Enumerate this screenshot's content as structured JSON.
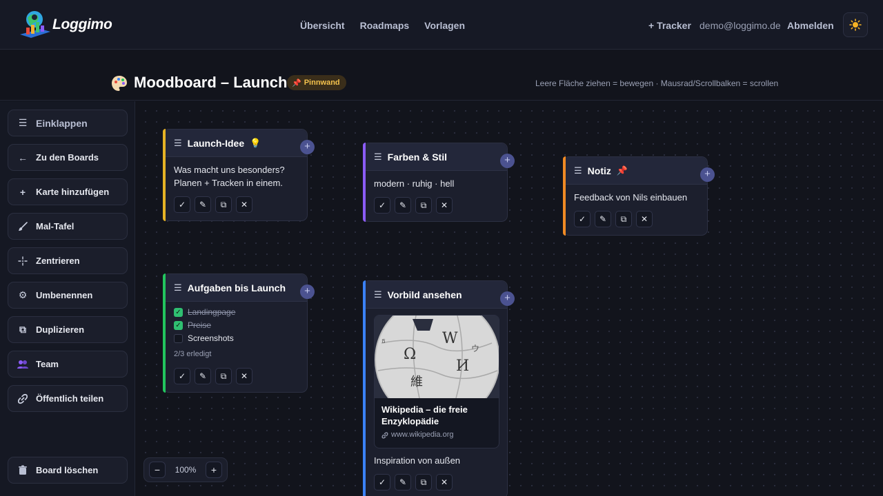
{
  "app": {
    "name": "Loggimo"
  },
  "nav": {
    "links": [
      "Übersicht",
      "Roadmaps",
      "Vorlagen"
    ],
    "tracker": "+ Tracker",
    "email": "demo@loggimo.de",
    "logout": "Abmelden",
    "theme_icon": "sun-icon"
  },
  "board": {
    "title": "Moodboard – Launch",
    "badge": "Pinnwand",
    "hint": "Leere Fläche ziehen = bewegen · Mausrad/Scrollbalken = scrollen"
  },
  "sidebar": {
    "collapse": "Einklappen",
    "items": [
      {
        "label": "Zu den Boards",
        "icon": "arrow-left-icon"
      },
      {
        "label": "Karte hinzufügen",
        "icon": "plus-icon"
      },
      {
        "label": "Mal-Tafel",
        "icon": "brush-icon"
      },
      {
        "label": "Zentrieren",
        "icon": "center-icon"
      },
      {
        "label": "Umbenennen",
        "icon": "gear-icon"
      },
      {
        "label": "Duplizieren",
        "icon": "copy-icon"
      },
      {
        "label": "Team",
        "icon": "team-icon"
      },
      {
        "label": "Öffentlich teilen",
        "icon": "link-icon"
      }
    ],
    "delete": "Board löschen"
  },
  "cards": {
    "launch": {
      "title": "Launch-Idee",
      "emoji": "💡",
      "text1": "Was macht uns besonders?",
      "text2": "Planen + Tracken in einem.",
      "accent": "#e6b325"
    },
    "colors": {
      "title": "Farben & Stil",
      "text": "modern · ruhig · hell",
      "accent": "#8b5cf6"
    },
    "note": {
      "title": "Notiz",
      "emoji": "📌",
      "text": "Feedback von Nils einbauen",
      "accent": "#f08a24"
    },
    "tasks": {
      "title": "Aufgaben bis Launch",
      "items": [
        {
          "label": "Landingpage",
          "done": true
        },
        {
          "label": "Preise",
          "done": true
        },
        {
          "label": "Screenshots",
          "done": false
        }
      ],
      "progress": "2/3 erledigt",
      "accent": "#22c55e"
    },
    "model": {
      "title": "Vorbild ansehen",
      "preview_title": "Wikipedia – die freie Enzyklopädie",
      "preview_url": "www.wikipedia.org",
      "text": "Inspiration von außen",
      "accent": "#3b82f6"
    }
  },
  "zoom": {
    "value": "100%"
  }
}
